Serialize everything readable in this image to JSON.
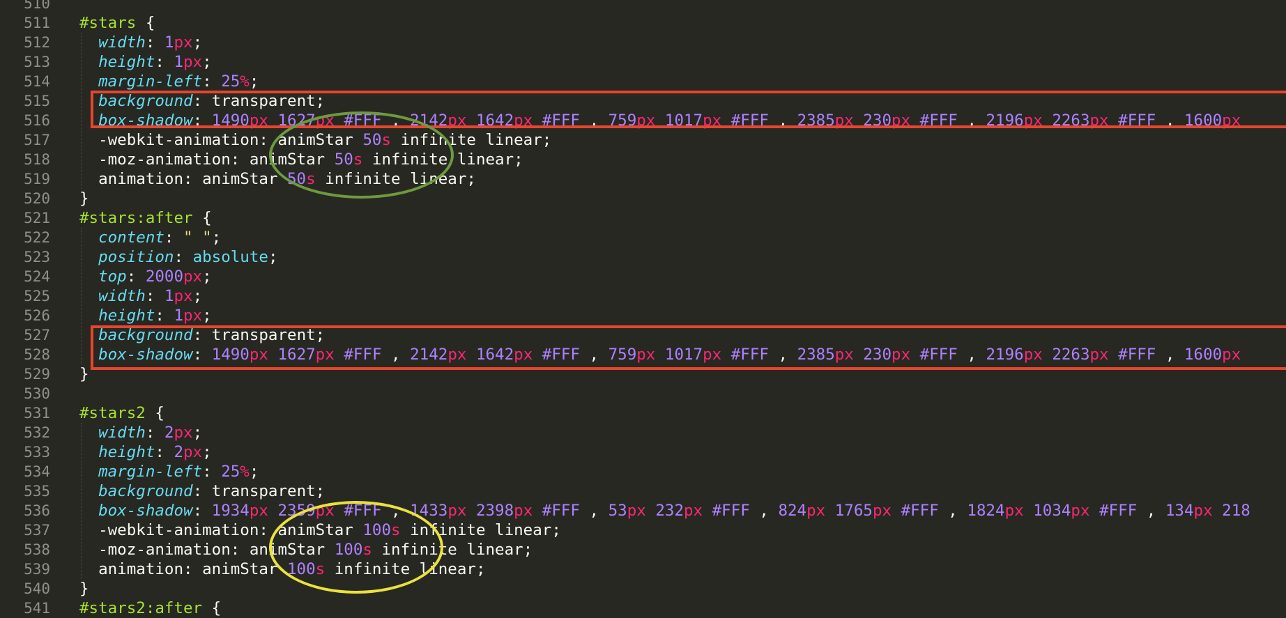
{
  "editor": {
    "theme_colors": {
      "background": "#272822",
      "selector": "#a6e22e",
      "property": "#66d9ef",
      "number": "#ae81ff",
      "unit": "#f92672",
      "string": "#e6db74",
      "text": "#f8f8f2",
      "gutter": "#8f908a"
    },
    "lines": [
      {
        "n": "510",
        "tokens": [
          {
            "t": "",
            "c": "plain"
          }
        ]
      },
      {
        "n": "511",
        "tokens": [
          {
            "t": "#stars",
            "c": "sel"
          },
          {
            "t": " {",
            "c": "plain"
          }
        ]
      },
      {
        "n": "512",
        "tokens": [
          {
            "t": "  "
          },
          {
            "t": "width",
            "c": "prop"
          },
          {
            "t": ": ",
            "c": "plain"
          },
          {
            "t": "1",
            "c": "num"
          },
          {
            "t": "px",
            "c": "unit"
          },
          {
            "t": ";",
            "c": "plain"
          }
        ]
      },
      {
        "n": "513",
        "tokens": [
          {
            "t": "  "
          },
          {
            "t": "height",
            "c": "prop"
          },
          {
            "t": ": ",
            "c": "plain"
          },
          {
            "t": "1",
            "c": "num"
          },
          {
            "t": "px",
            "c": "unit"
          },
          {
            "t": ";",
            "c": "plain"
          }
        ]
      },
      {
        "n": "514",
        "tokens": [
          {
            "t": "  "
          },
          {
            "t": "margin-left",
            "c": "prop"
          },
          {
            "t": ": ",
            "c": "plain"
          },
          {
            "t": "25",
            "c": "num"
          },
          {
            "t": "%",
            "c": "unit"
          },
          {
            "t": ";",
            "c": "plain"
          }
        ]
      },
      {
        "n": "515",
        "tokens": [
          {
            "t": "  "
          },
          {
            "t": "background",
            "c": "prop"
          },
          {
            "t": ": ",
            "c": "plain"
          },
          {
            "t": "transparent",
            "c": "plain"
          },
          {
            "t": ";",
            "c": "plain"
          }
        ]
      },
      {
        "n": "516",
        "tokens": [
          {
            "t": "  "
          },
          {
            "t": "box-shadow",
            "c": "prop"
          },
          {
            "t": ": ",
            "c": "plain"
          },
          {
            "t": "1490",
            "c": "num"
          },
          {
            "t": "px",
            "c": "unit"
          },
          {
            "t": " "
          },
          {
            "t": "1627",
            "c": "num"
          },
          {
            "t": "px",
            "c": "unit"
          },
          {
            "t": " "
          },
          {
            "t": "#FFF",
            "c": "hex"
          },
          {
            "t": " , "
          },
          {
            "t": "2142",
            "c": "num"
          },
          {
            "t": "px",
            "c": "unit"
          },
          {
            "t": " "
          },
          {
            "t": "1642",
            "c": "num"
          },
          {
            "t": "px",
            "c": "unit"
          },
          {
            "t": " "
          },
          {
            "t": "#FFF",
            "c": "hex"
          },
          {
            "t": " , "
          },
          {
            "t": "759",
            "c": "num"
          },
          {
            "t": "px",
            "c": "unit"
          },
          {
            "t": " "
          },
          {
            "t": "1017",
            "c": "num"
          },
          {
            "t": "px",
            "c": "unit"
          },
          {
            "t": " "
          },
          {
            "t": "#FFF",
            "c": "hex"
          },
          {
            "t": " , "
          },
          {
            "t": "2385",
            "c": "num"
          },
          {
            "t": "px",
            "c": "unit"
          },
          {
            "t": " "
          },
          {
            "t": "230",
            "c": "num"
          },
          {
            "t": "px",
            "c": "unit"
          },
          {
            "t": " "
          },
          {
            "t": "#FFF",
            "c": "hex"
          },
          {
            "t": " , "
          },
          {
            "t": "2196",
            "c": "num"
          },
          {
            "t": "px",
            "c": "unit"
          },
          {
            "t": " "
          },
          {
            "t": "2263",
            "c": "num"
          },
          {
            "t": "px",
            "c": "unit"
          },
          {
            "t": " "
          },
          {
            "t": "#FFF",
            "c": "hex"
          },
          {
            "t": " , "
          },
          {
            "t": "1600",
            "c": "num"
          },
          {
            "t": "px",
            "c": "unit"
          }
        ]
      },
      {
        "n": "517",
        "tokens": [
          {
            "t": "  -webkit-animation: animStar "
          },
          {
            "t": "50",
            "c": "num"
          },
          {
            "t": "s",
            "c": "unit"
          },
          {
            "t": " infinite linear;"
          }
        ]
      },
      {
        "n": "518",
        "tokens": [
          {
            "t": "  -moz-animation: animStar "
          },
          {
            "t": "50",
            "c": "num"
          },
          {
            "t": "s",
            "c": "unit"
          },
          {
            "t": " infinite linear;"
          }
        ]
      },
      {
        "n": "519",
        "tokens": [
          {
            "t": "  animation: animStar "
          },
          {
            "t": "50",
            "c": "num"
          },
          {
            "t": "s",
            "c": "unit"
          },
          {
            "t": " infinite linear;"
          }
        ]
      },
      {
        "n": "520",
        "tokens": [
          {
            "t": "}"
          }
        ]
      },
      {
        "n": "521",
        "tokens": [
          {
            "t": "#stars:after",
            "c": "sel"
          },
          {
            "t": " {"
          }
        ]
      },
      {
        "n": "522",
        "tokens": [
          {
            "t": "  "
          },
          {
            "t": "content",
            "c": "prop"
          },
          {
            "t": ": "
          },
          {
            "t": "\" \"",
            "c": "str"
          },
          {
            "t": ";"
          }
        ]
      },
      {
        "n": "523",
        "tokens": [
          {
            "t": "  "
          },
          {
            "t": "position",
            "c": "prop"
          },
          {
            "t": ": "
          },
          {
            "t": "absolute",
            "c": "kw"
          },
          {
            "t": ";"
          }
        ]
      },
      {
        "n": "524",
        "tokens": [
          {
            "t": "  "
          },
          {
            "t": "top",
            "c": "prop"
          },
          {
            "t": ": "
          },
          {
            "t": "2000",
            "c": "num"
          },
          {
            "t": "px",
            "c": "unit"
          },
          {
            "t": ";"
          }
        ]
      },
      {
        "n": "525",
        "tokens": [
          {
            "t": "  "
          },
          {
            "t": "width",
            "c": "prop"
          },
          {
            "t": ": "
          },
          {
            "t": "1",
            "c": "num"
          },
          {
            "t": "px",
            "c": "unit"
          },
          {
            "t": ";"
          }
        ]
      },
      {
        "n": "526",
        "tokens": [
          {
            "t": "  "
          },
          {
            "t": "height",
            "c": "prop"
          },
          {
            "t": ": "
          },
          {
            "t": "1",
            "c": "num"
          },
          {
            "t": "px",
            "c": "unit"
          },
          {
            "t": ";"
          }
        ]
      },
      {
        "n": "527",
        "tokens": [
          {
            "t": "  "
          },
          {
            "t": "background",
            "c": "prop"
          },
          {
            "t": ": "
          },
          {
            "t": "transparent"
          },
          {
            "t": ";"
          }
        ]
      },
      {
        "n": "528",
        "tokens": [
          {
            "t": "  "
          },
          {
            "t": "box-shadow",
            "c": "prop"
          },
          {
            "t": ": "
          },
          {
            "t": "1490",
            "c": "num"
          },
          {
            "t": "px",
            "c": "unit"
          },
          {
            "t": " "
          },
          {
            "t": "1627",
            "c": "num"
          },
          {
            "t": "px",
            "c": "unit"
          },
          {
            "t": " "
          },
          {
            "t": "#FFF",
            "c": "hex"
          },
          {
            "t": " , "
          },
          {
            "t": "2142",
            "c": "num"
          },
          {
            "t": "px",
            "c": "unit"
          },
          {
            "t": " "
          },
          {
            "t": "1642",
            "c": "num"
          },
          {
            "t": "px",
            "c": "unit"
          },
          {
            "t": " "
          },
          {
            "t": "#FFF",
            "c": "hex"
          },
          {
            "t": " , "
          },
          {
            "t": "759",
            "c": "num"
          },
          {
            "t": "px",
            "c": "unit"
          },
          {
            "t": " "
          },
          {
            "t": "1017",
            "c": "num"
          },
          {
            "t": "px",
            "c": "unit"
          },
          {
            "t": " "
          },
          {
            "t": "#FFF",
            "c": "hex"
          },
          {
            "t": " , "
          },
          {
            "t": "2385",
            "c": "num"
          },
          {
            "t": "px",
            "c": "unit"
          },
          {
            "t": " "
          },
          {
            "t": "230",
            "c": "num"
          },
          {
            "t": "px",
            "c": "unit"
          },
          {
            "t": " "
          },
          {
            "t": "#FFF",
            "c": "hex"
          },
          {
            "t": " , "
          },
          {
            "t": "2196",
            "c": "num"
          },
          {
            "t": "px",
            "c": "unit"
          },
          {
            "t": " "
          },
          {
            "t": "2263",
            "c": "num"
          },
          {
            "t": "px",
            "c": "unit"
          },
          {
            "t": " "
          },
          {
            "t": "#FFF",
            "c": "hex"
          },
          {
            "t": " , "
          },
          {
            "t": "1600",
            "c": "num"
          },
          {
            "t": "px",
            "c": "unit"
          }
        ]
      },
      {
        "n": "529",
        "tokens": [
          {
            "t": "}"
          }
        ]
      },
      {
        "n": "530",
        "tokens": [
          {
            "t": ""
          }
        ]
      },
      {
        "n": "531",
        "tokens": [
          {
            "t": "#stars2",
            "c": "sel"
          },
          {
            "t": " {"
          }
        ]
      },
      {
        "n": "532",
        "tokens": [
          {
            "t": "  "
          },
          {
            "t": "width",
            "c": "prop"
          },
          {
            "t": ": "
          },
          {
            "t": "2",
            "c": "num"
          },
          {
            "t": "px",
            "c": "unit"
          },
          {
            "t": ";"
          }
        ]
      },
      {
        "n": "533",
        "tokens": [
          {
            "t": "  "
          },
          {
            "t": "height",
            "c": "prop"
          },
          {
            "t": ": "
          },
          {
            "t": "2",
            "c": "num"
          },
          {
            "t": "px",
            "c": "unit"
          },
          {
            "t": ";"
          }
        ]
      },
      {
        "n": "534",
        "tokens": [
          {
            "t": "  "
          },
          {
            "t": "margin-left",
            "c": "prop"
          },
          {
            "t": ": "
          },
          {
            "t": "25",
            "c": "num"
          },
          {
            "t": "%",
            "c": "unit"
          },
          {
            "t": ";"
          }
        ]
      },
      {
        "n": "535",
        "tokens": [
          {
            "t": "  "
          },
          {
            "t": "background",
            "c": "prop"
          },
          {
            "t": ": "
          },
          {
            "t": "transparent"
          },
          {
            "t": ";"
          }
        ]
      },
      {
        "n": "536",
        "tokens": [
          {
            "t": "  "
          },
          {
            "t": "box-shadow",
            "c": "prop"
          },
          {
            "t": ": "
          },
          {
            "t": "1934",
            "c": "num"
          },
          {
            "t": "px",
            "c": "unit"
          },
          {
            "t": " "
          },
          {
            "t": "2359",
            "c": "num"
          },
          {
            "t": "px",
            "c": "unit"
          },
          {
            "t": " "
          },
          {
            "t": "#FFF",
            "c": "hex"
          },
          {
            "t": " , "
          },
          {
            "t": "1433",
            "c": "num"
          },
          {
            "t": "px",
            "c": "unit"
          },
          {
            "t": " "
          },
          {
            "t": "2398",
            "c": "num"
          },
          {
            "t": "px",
            "c": "unit"
          },
          {
            "t": " "
          },
          {
            "t": "#FFF",
            "c": "hex"
          },
          {
            "t": " , "
          },
          {
            "t": "53",
            "c": "num"
          },
          {
            "t": "px",
            "c": "unit"
          },
          {
            "t": " "
          },
          {
            "t": "232",
            "c": "num"
          },
          {
            "t": "px",
            "c": "unit"
          },
          {
            "t": " "
          },
          {
            "t": "#FFF",
            "c": "hex"
          },
          {
            "t": " , "
          },
          {
            "t": "824",
            "c": "num"
          },
          {
            "t": "px",
            "c": "unit"
          },
          {
            "t": " "
          },
          {
            "t": "1765",
            "c": "num"
          },
          {
            "t": "px",
            "c": "unit"
          },
          {
            "t": " "
          },
          {
            "t": "#FFF",
            "c": "hex"
          },
          {
            "t": " , "
          },
          {
            "t": "1824",
            "c": "num"
          },
          {
            "t": "px",
            "c": "unit"
          },
          {
            "t": " "
          },
          {
            "t": "1034",
            "c": "num"
          },
          {
            "t": "px",
            "c": "unit"
          },
          {
            "t": " "
          },
          {
            "t": "#FFF",
            "c": "hex"
          },
          {
            "t": " , "
          },
          {
            "t": "134",
            "c": "num"
          },
          {
            "t": "px",
            "c": "unit"
          },
          {
            "t": " "
          },
          {
            "t": "218",
            "c": "num"
          }
        ]
      },
      {
        "n": "537",
        "tokens": [
          {
            "t": "  -webkit-animation: animStar "
          },
          {
            "t": "100",
            "c": "num"
          },
          {
            "t": "s",
            "c": "unit"
          },
          {
            "t": " infinite linear;"
          }
        ]
      },
      {
        "n": "538",
        "tokens": [
          {
            "t": "  -moz-animation: animStar "
          },
          {
            "t": "100",
            "c": "num"
          },
          {
            "t": "s",
            "c": "unit"
          },
          {
            "t": " infinite linear;"
          }
        ]
      },
      {
        "n": "539",
        "tokens": [
          {
            "t": "  animation: animStar "
          },
          {
            "t": "100",
            "c": "num"
          },
          {
            "t": "s",
            "c": "unit"
          },
          {
            "t": " infinite linear;"
          }
        ]
      },
      {
        "n": "540",
        "tokens": [
          {
            "t": "}"
          }
        ]
      },
      {
        "n": "541",
        "tokens": [
          {
            "t": "#stars2:after",
            "c": "sel"
          },
          {
            "t": " {"
          }
        ]
      }
    ]
  },
  "annotations": {
    "red_box_color": "#e8452c",
    "green_oval_color": "#6e9a3e",
    "yellow_oval_color": "#e9e23a"
  }
}
